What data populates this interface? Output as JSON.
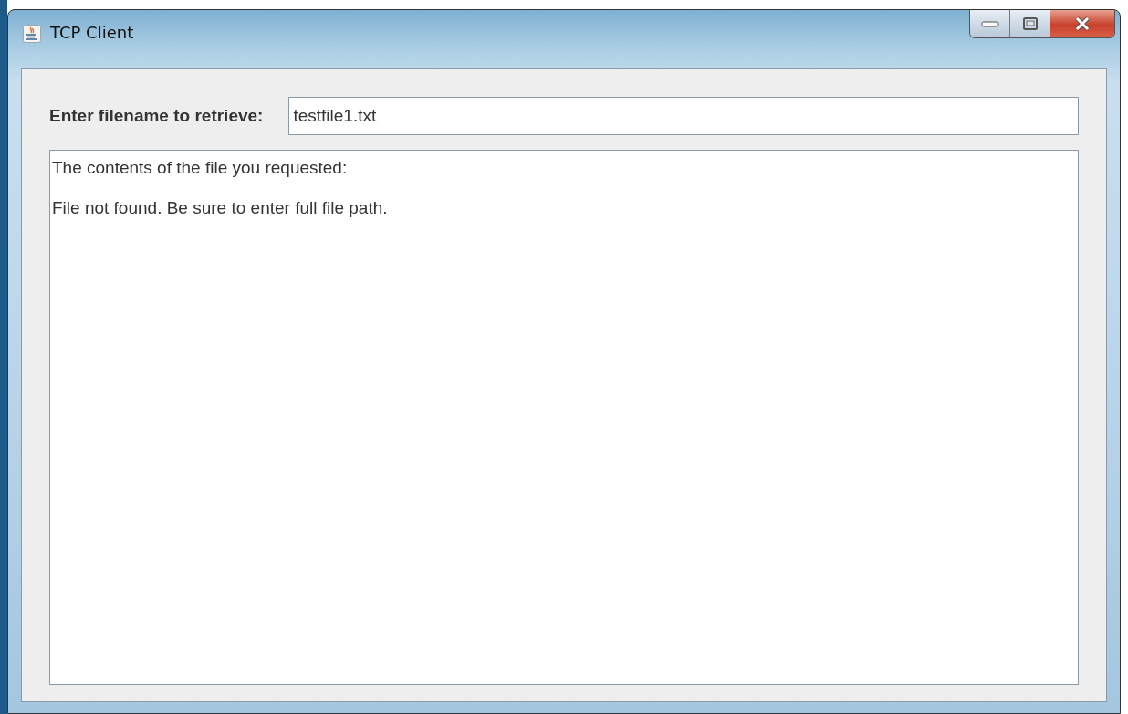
{
  "window": {
    "title": "TCP Client"
  },
  "form": {
    "label": "Enter filename to retrieve:",
    "field_value": "testfile1.txt"
  },
  "output": {
    "lines": [
      "The contents of the file you requested:",
      "File not found. Be sure to enter full file path."
    ]
  }
}
